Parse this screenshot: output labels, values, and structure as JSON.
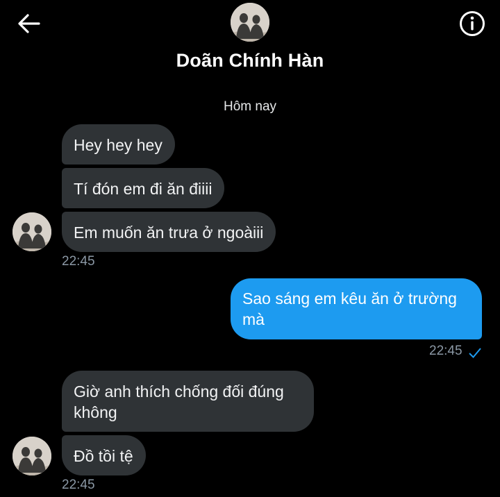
{
  "header": {
    "contact_name": "Doãn Chính Hàn",
    "back_icon": "arrow-left-icon",
    "info_icon": "info-circle-icon"
  },
  "conversation": {
    "date_separator": "Hôm nay",
    "messages": [
      {
        "direction": "incoming",
        "text": "Hey hey hey"
      },
      {
        "direction": "incoming",
        "text": "Tí đón em đi ăn điiii"
      },
      {
        "direction": "incoming",
        "text": "Em muốn ăn trưa ở ngoàiii"
      },
      {
        "direction": "outgoing",
        "text": "Sao sáng em kêu ăn ở trường mà"
      },
      {
        "direction": "incoming",
        "text": "Giờ anh thích chống đối đúng không"
      },
      {
        "direction": "incoming",
        "text": "Đồ tồi tệ"
      }
    ],
    "timestamps": {
      "group1": "22:45",
      "outgoing": "22:45",
      "group2": "22:45"
    },
    "read_receipt_icon": "checkmark-icon"
  },
  "colors": {
    "background": "#000000",
    "incoming_bubble": "#2f3336",
    "outgoing_bubble": "#1d9bf0",
    "timestamp": "#8b98a5",
    "check": "#1d9bf0"
  }
}
